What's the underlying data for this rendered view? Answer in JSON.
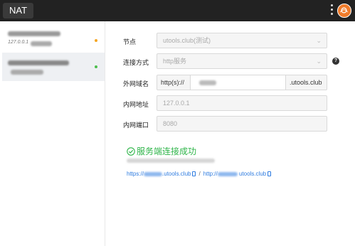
{
  "app": {
    "title": "NAT"
  },
  "sidebar": {
    "items": [
      {
        "sub": "127.0.0.1",
        "status_color": "#f5a623"
      },
      {
        "status_color": "#4cbe4c"
      }
    ]
  },
  "form": {
    "node_label": "节点",
    "node_value": "utools.club(测试)",
    "mode_label": "连接方式",
    "mode_value": "http服务",
    "help_glyph": "?",
    "domain_label": "外网域名",
    "domain_prefix": "http(s)://",
    "domain_suffix": ".utools.club",
    "host_label": "内网地址",
    "host_value": "127.0.0.1",
    "port_label": "内网端口",
    "port_value": "8080"
  },
  "result": {
    "success_text": "服务端连接成功",
    "success_color": "#2fb54a",
    "links": [
      {
        "prefix": "https://",
        "suffix": ".utools.club"
      },
      {
        "prefix": "http://",
        "suffix": "utools.club"
      }
    ],
    "separator": "/"
  }
}
